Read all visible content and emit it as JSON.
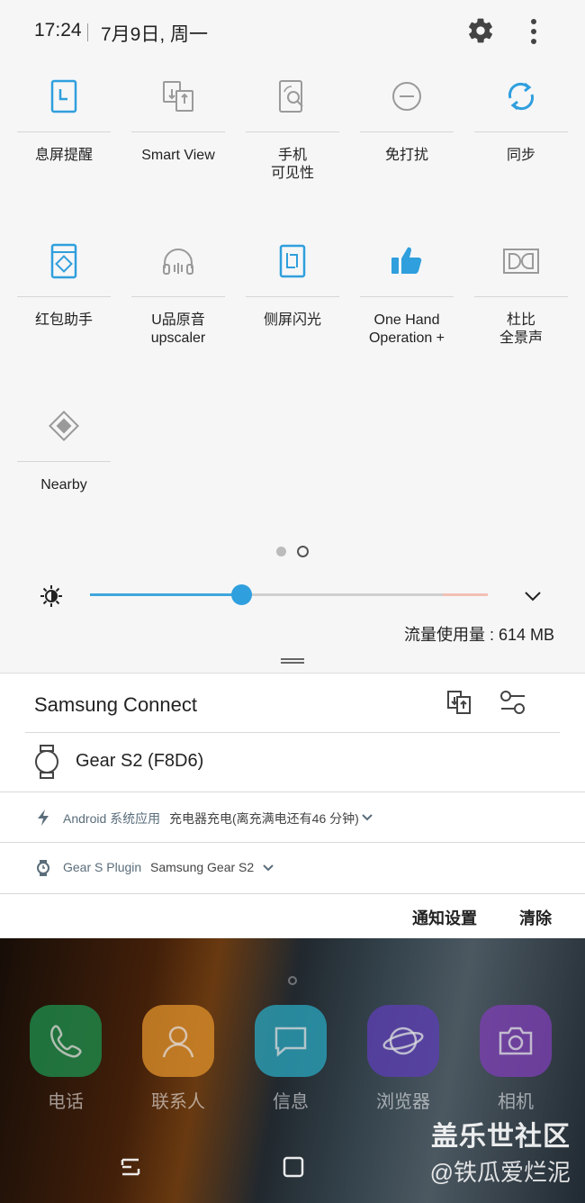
{
  "status": {
    "time": "17:24",
    "date": "7月9日, 周一"
  },
  "tiles": [
    {
      "label": "息屏提醒",
      "icon": "always-on-display-icon",
      "active": true
    },
    {
      "label": "Smart View",
      "icon": "smart-view-icon",
      "active": false
    },
    {
      "label": "手机\n可见性",
      "icon": "phone-visibility-icon",
      "active": false
    },
    {
      "label": "免打扰",
      "icon": "do-not-disturb-icon",
      "active": false
    },
    {
      "label": "同步",
      "icon": "sync-icon",
      "active": true
    },
    {
      "label": "红包助手",
      "icon": "red-envelope-icon",
      "active": true
    },
    {
      "label": "U品原音\nupscaler",
      "icon": "headphones-icon",
      "active": false
    },
    {
      "label": "侧屏闪光",
      "icon": "edge-lighting-icon",
      "active": true
    },
    {
      "label": "One Hand\nOperation +",
      "icon": "thumbs-up-icon",
      "active": true
    },
    {
      "label": "杜比\n全景声",
      "icon": "dolby-icon",
      "active": false
    },
    {
      "label": "Nearby",
      "icon": "nearby-icon",
      "active": false
    }
  ],
  "brightness": {
    "level": 0.38
  },
  "data_usage": "流量使用量 : 614 MB",
  "samsung_connect": {
    "title": "Samsung Connect",
    "device": "Gear S2 (F8D6)"
  },
  "notifications": [
    {
      "app": "Android 系统应用",
      "text": "充电器充电(离充满电还有46 分钟)",
      "icon": "lightning-icon"
    },
    {
      "app": "Gear S Plugin",
      "text": "Samsung Gear S2",
      "icon": "watch-icon"
    }
  ],
  "footer": {
    "settings": "通知设置",
    "clear": "清除"
  },
  "dock": [
    {
      "label": "电话",
      "icon": "phone-icon",
      "color": "#1f8a4a"
    },
    {
      "label": "联系人",
      "icon": "contact-icon",
      "color": "#e0932a"
    },
    {
      "label": "信息",
      "icon": "message-icon",
      "color": "#2aa0b8"
    },
    {
      "label": "浏览器",
      "icon": "browser-icon",
      "color": "#5b3fb0"
    },
    {
      "label": "相机",
      "icon": "camera-icon",
      "color": "#7a3fb0"
    }
  ],
  "watermark": {
    "line1": "盖乐世社区",
    "line2": "@铁瓜爱烂泥"
  },
  "colors": {
    "accent": "#2f9fdd",
    "inactive_icon": "#9a9a9a"
  }
}
